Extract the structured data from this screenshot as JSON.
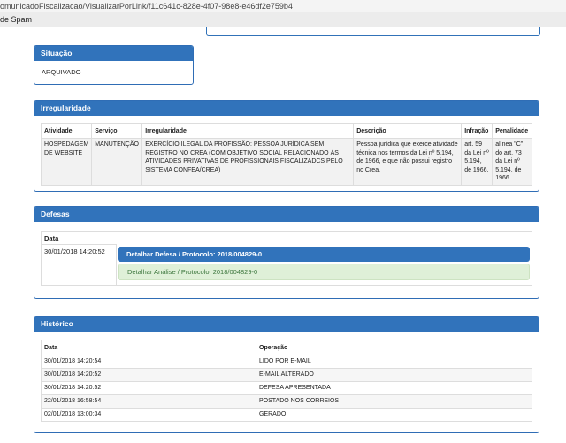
{
  "browser": {
    "url_fragment": "omunicadoFiscalizacao/VisualizarPorLink/f11c641c-828e-4f07-98e8-e46df2e759b4",
    "bookmark_fragment": "de Spam"
  },
  "situacao": {
    "title": "Situação",
    "value": "ARQUIVADO"
  },
  "irregularidade": {
    "title": "Irregularidade",
    "columns": [
      "Atividade",
      "Serviço",
      "Irregularidade",
      "Descrição",
      "Infração",
      "Penalidade"
    ],
    "rows": [
      {
        "atividade": "HOSPEDAGEM DE WEBSITE",
        "servico": "MANUTENÇÃO",
        "irregularidade": "EXERCÍCIO ILEGAL DA PROFISSÃO: PESSOA JURÍDICA SEM REGISTRO NO CREA (COM OBJETIVO SOCIAL RELACIONADO ÀS ATIVIDADES PRIVATIVAS DE PROFISSIONAIS FISCALIZADCS PELO SISTEMA CONFEA/CREA)",
        "descricao": "Pessoa jurídica que exerce atividade técnica nos termos da Lei nº 5.194, de 1966, e que não possui registro no Crea.",
        "infracao": "art. 59 da Lei nº 5.194, de 1966.",
        "penalidade": "alínea \"C\" do art. 73 da Lei nº 5.194, de 1966."
      }
    ]
  },
  "defesas": {
    "title": "Defesas",
    "date_header": "Data",
    "date": "30/01/2018 14:20:52",
    "detail_button": "Detalhar Defesa / Protocolo: 2018/004829-0",
    "analysis_button": "Detalhar Análise / Protocolo: 2018/004829-0"
  },
  "historico": {
    "title": "Histórico",
    "columns": [
      "Data",
      "Operação"
    ],
    "rows": [
      {
        "data": "30/01/2018 14:20:54",
        "operacao": "LIDO POR E-MAIL"
      },
      {
        "data": "30/01/2018 14:20:52",
        "operacao": "E-MAIL ALTERADO"
      },
      {
        "data": "30/01/2018 14:20:52",
        "operacao": "DEFESA APRESENTADA"
      },
      {
        "data": "22/01/2018 16:58:54",
        "operacao": "POSTADO NOS CORREIOS"
      },
      {
        "data": "02/01/2018 13:00:34",
        "operacao": "GERADO"
      }
    ]
  }
}
